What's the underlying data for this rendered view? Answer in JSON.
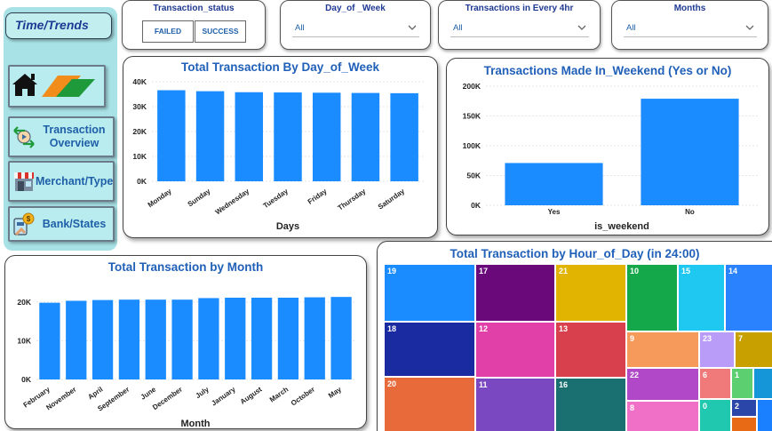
{
  "nav": {
    "title": "Time/Trends",
    "buttons": [
      {
        "label": "Transaction Overview"
      },
      {
        "label": "Merchant/Type"
      },
      {
        "label": "Bank/States"
      }
    ]
  },
  "slicers": {
    "status": {
      "title": "Transaction_status",
      "options": [
        "FAILED",
        "SUCCESS"
      ]
    },
    "day_of_week": {
      "title": "Day_of _Week",
      "value": "All"
    },
    "every_4hr": {
      "title": "Transactions in Every 4hr",
      "value": "All"
    },
    "months": {
      "title": "Months",
      "value": "All"
    }
  },
  "colors": {
    "bar": "#1a8cff",
    "title": "#2060b8",
    "nav_bg": "#a8e2e6"
  },
  "chart_data": [
    {
      "type": "bar",
      "title": "Total Transaction By Day_of_Week",
      "xlabel": "Days",
      "ylabel": "",
      "categories": [
        "Monday",
        "Sunday",
        "Wednesday",
        "Tuesday",
        "Friday",
        "Thursday",
        "Saturday"
      ],
      "values": [
        36600,
        36200,
        35800,
        35700,
        35600,
        35500,
        35400
      ],
      "ylim": [
        0,
        40000
      ],
      "yticks": [
        "0K",
        "10K",
        "20K",
        "30K",
        "40K"
      ],
      "grid": true,
      "legend": "none"
    },
    {
      "type": "bar",
      "title": "Transactions Made In_Weekend (Yes or No)",
      "xlabel": "is_weekend",
      "ylabel": "",
      "categories": [
        "Yes",
        "No"
      ],
      "values": [
        71000,
        179000
      ],
      "ylim": [
        0,
        200000
      ],
      "yticks": [
        "0K",
        "50K",
        "100K",
        "150K",
        "200K"
      ],
      "grid": true,
      "legend": "none"
    },
    {
      "type": "bar",
      "title": "Total Transaction by Month",
      "xlabel": "Month",
      "ylabel": "",
      "categories": [
        "February",
        "November",
        "April",
        "September",
        "June",
        "December",
        "July",
        "January",
        "August",
        "March",
        "October",
        "May"
      ],
      "values": [
        19800,
        20300,
        20500,
        20600,
        20600,
        20600,
        21000,
        21100,
        21100,
        21100,
        21200,
        21300
      ],
      "ylim": [
        0,
        25000
      ],
      "yticks": [
        "0K",
        "10K",
        "20K"
      ],
      "grid": true,
      "legend": "none"
    },
    {
      "type": "heatmap",
      "title": "Total Transaction by Hour_of_Day (in 24:00)",
      "cells": [
        {
          "label": "19",
          "color": "#1a8cff"
        },
        {
          "label": "18",
          "color": "#1a2aa0"
        },
        {
          "label": "20",
          "color": "#e86a3a"
        },
        {
          "label": "17",
          "color": "#6a0a7a"
        },
        {
          "label": "12",
          "color": "#e040a8"
        },
        {
          "label": "11",
          "color": "#7a48c0"
        },
        {
          "label": "21",
          "color": "#e0b400"
        },
        {
          "label": "13",
          "color": "#d8404e"
        },
        {
          "label": "16",
          "color": "#1a7070"
        },
        {
          "label": "10",
          "color": "#14a84a"
        },
        {
          "label": "15",
          "color": "#1ec8f0"
        },
        {
          "label": "14",
          "color": "#2a82ff"
        },
        {
          "label": "9",
          "color": "#f59a5a"
        },
        {
          "label": "23",
          "color": "#b89cf8"
        },
        {
          "label": "7",
          "color": "#c8a000"
        },
        {
          "label": "22",
          "color": "#b048c8"
        },
        {
          "label": "6",
          "color": "#f07a7a"
        },
        {
          "label": "1",
          "color": "#5cd070"
        },
        {
          "label": "",
          "color": "#1496d8"
        },
        {
          "label": "8",
          "color": "#f070c8"
        },
        {
          "label": "0",
          "color": "#20c8b0"
        },
        {
          "label": "2",
          "color": "#2a46a8"
        },
        {
          "label": "",
          "color": "#e86a14"
        },
        {
          "label": "",
          "color": "#1a80ff"
        }
      ]
    }
  ]
}
